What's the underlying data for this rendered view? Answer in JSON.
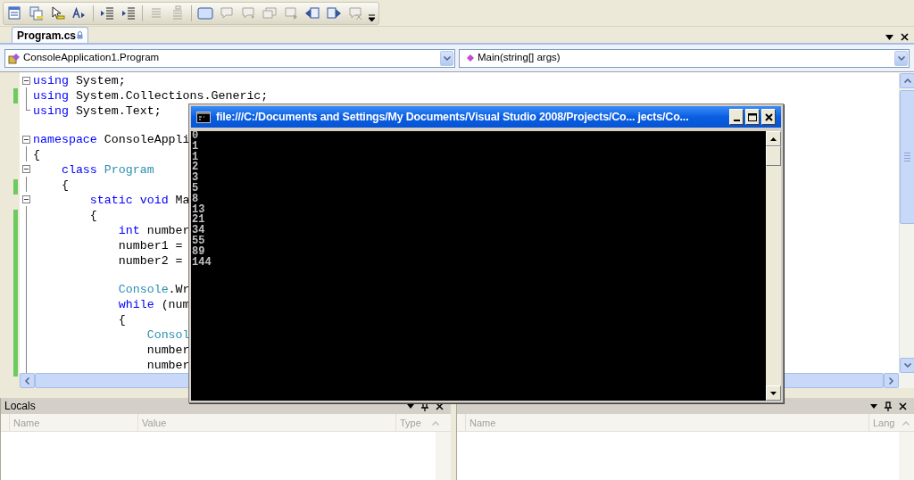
{
  "document_tab": {
    "label": "Program.cs",
    "selected": true
  },
  "navigation": {
    "type_combo": "ConsoleApplication1.Program",
    "member_combo": "Main(string[] args)"
  },
  "code_lines": [
    {
      "expanded": true,
      "changed": false,
      "tokens": [
        {
          "text": "using",
          "kind": "keyword"
        },
        {
          "text": " System;",
          "kind": "plain"
        }
      ]
    },
    {
      "changed": true,
      "tokens": [
        {
          "text": "using",
          "kind": "keyword"
        },
        {
          "text": " System.Collections.Generic;",
          "kind": "plain"
        }
      ]
    },
    {
      "changed": false,
      "tokens": [
        {
          "text": "using",
          "kind": "keyword"
        },
        {
          "text": " System.Text;",
          "kind": "plain"
        }
      ]
    },
    {
      "changed": false
    },
    {
      "expanded": true,
      "changed": false,
      "tokens": [
        {
          "text": "namespace",
          "kind": "keyword"
        },
        {
          "text": " ConsoleAppli",
          "kind": "plain"
        }
      ]
    },
    {
      "changed": false,
      "tokens": [
        {
          "text": "{",
          "kind": "plain"
        }
      ]
    },
    {
      "expanded": true,
      "changed": false,
      "tokens": [
        {
          "text": "    class",
          "kind": "keyword"
        },
        {
          "text": " Program",
          "kind": "type"
        }
      ]
    },
    {
      "changed": true,
      "tokens": [
        {
          "text": "    {",
          "kind": "plain"
        }
      ]
    },
    {
      "expanded": true,
      "changed": false,
      "tokens": [
        {
          "text": "        static",
          "kind": "keyword"
        },
        {
          "text": " void",
          "kind": "keyword"
        },
        {
          "text": " Ma",
          "kind": "plain"
        }
      ]
    },
    {
      "changed": true,
      "tokens": [
        {
          "text": "        {",
          "kind": "plain"
        }
      ]
    },
    {
      "changed": true,
      "tokens": [
        {
          "text": "            int",
          "kind": "keyword"
        },
        {
          "text": " number",
          "kind": "plain"
        }
      ]
    },
    {
      "changed": true,
      "tokens": [
        {
          "text": "            number1 =",
          "kind": "plain"
        }
      ]
    },
    {
      "changed": true,
      "tokens": [
        {
          "text": "            number2 =",
          "kind": "plain"
        }
      ]
    },
    {
      "changed": true
    },
    {
      "changed": true,
      "tokens": [
        {
          "text": "            Console",
          "kind": "type"
        },
        {
          "text": ".Wr",
          "kind": "plain"
        }
      ]
    },
    {
      "changed": true,
      "tokens": [
        {
          "text": "            while",
          "kind": "keyword"
        },
        {
          "text": " (num",
          "kind": "plain"
        }
      ]
    },
    {
      "changed": true,
      "tokens": [
        {
          "text": "            {",
          "kind": "plain"
        }
      ]
    },
    {
      "changed": true,
      "tokens": [
        {
          "text": "                Consol",
          "kind": "type"
        }
      ]
    },
    {
      "changed": true,
      "tokens": [
        {
          "text": "                number",
          "kind": "plain"
        }
      ]
    },
    {
      "changed": true,
      "tokens": [
        {
          "text": "                number",
          "kind": "plain"
        }
      ]
    }
  ],
  "console_window": {
    "title": "file:///C:/Documents and Settings/My Documents/Visual Studio 2008/Projects/Co... jects/Co...",
    "output": [
      "0",
      "1",
      "1",
      "2",
      "3",
      "5",
      "8",
      "13",
      "21",
      "34",
      "55",
      "89",
      "144"
    ]
  },
  "locals_panel": {
    "title": "Locals",
    "columns": [
      "Name",
      "Value",
      "Type"
    ]
  },
  "call_stack_panel": {
    "columns": [
      "Name",
      "Lang"
    ]
  }
}
